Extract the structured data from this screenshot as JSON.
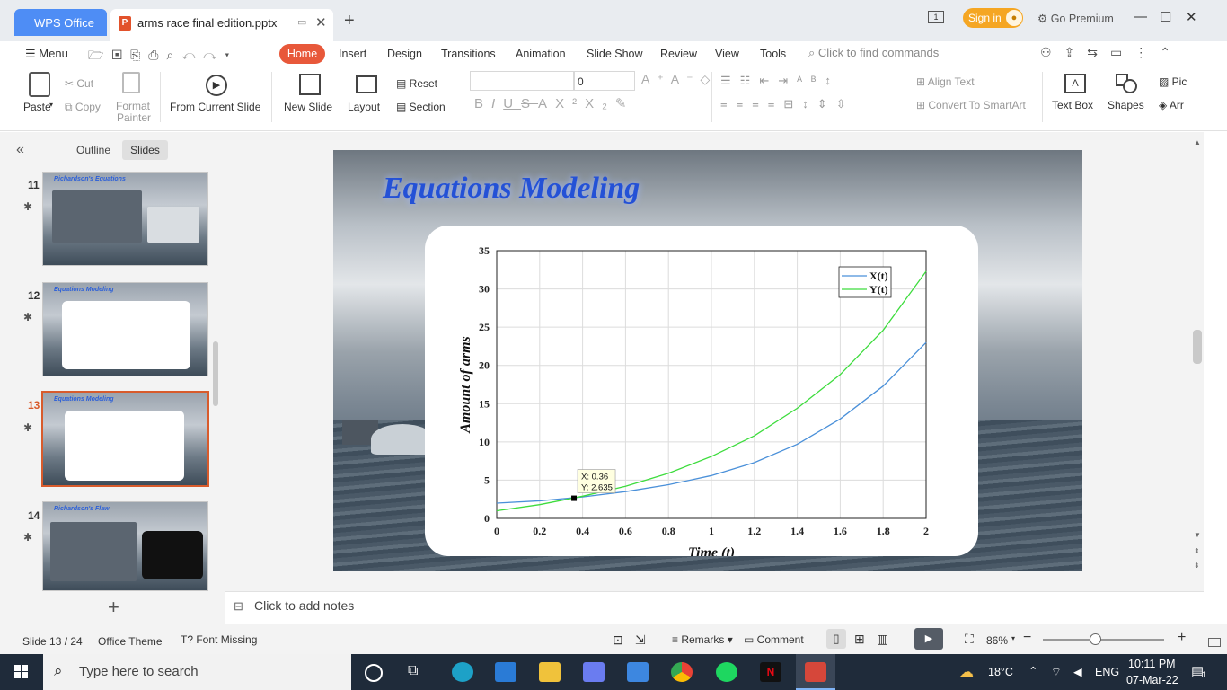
{
  "titlebar": {
    "app_tab": "WPS Office",
    "doc_tab": "arms race final edition.pptx",
    "doc_icon_letter": "P",
    "new_tab_icon": "plus-icon",
    "pages_badge": "1",
    "signin": "Sign in",
    "go_premium": "Go Premium"
  },
  "menu": {
    "menu_label": "Menu",
    "tabs": [
      "Home",
      "Insert",
      "Design",
      "Transitions",
      "Animation",
      "Slide Show",
      "Review",
      "View",
      "Tools"
    ],
    "search_placeholder": "Click to find commands"
  },
  "ribbon": {
    "paste": "Paste",
    "cut": "Cut",
    "copy": "Copy",
    "format_painter_1": "Format",
    "format_painter_2": "Painter",
    "from_current_slide": "From Current Slide",
    "new_slide": "New Slide",
    "layout": "Layout",
    "reset": "Reset",
    "section": "Section",
    "font_size": "0",
    "align_text": "Align Text",
    "convert_smartart": "Convert To SmartArt",
    "text_box": "Text Box",
    "shapes": "Shapes",
    "pic": "Pic",
    "arr": "Arr"
  },
  "left_panel": {
    "outline": "Outline",
    "slides": "Slides",
    "thumbnails": [
      {
        "num": "11",
        "title": "Richardson's Equations"
      },
      {
        "num": "12",
        "title": "Equations Modeling"
      },
      {
        "num": "13",
        "title": "Equations Modeling"
      },
      {
        "num": "14",
        "title": "Richardson's Flaw"
      }
    ]
  },
  "slide": {
    "title": "Equations Modeling"
  },
  "chart_data": {
    "type": "line",
    "title": "",
    "xlabel": "Time (t)",
    "ylabel": "Amount of arms",
    "xlim": [
      0,
      2
    ],
    "ylim": [
      0,
      35
    ],
    "xticks": [
      "0",
      "0.2",
      "0.4",
      "0.6",
      "0.8",
      "1",
      "1.2",
      "1.4",
      "1.6",
      "1.8",
      "2"
    ],
    "yticks": [
      "0",
      "5",
      "10",
      "15",
      "20",
      "25",
      "30",
      "35"
    ],
    "grid": true,
    "legend_position": "top-right",
    "series": [
      {
        "name": "X(t)",
        "color": "#4a90d9",
        "x": [
          0,
          0.2,
          0.4,
          0.6,
          0.8,
          1.0,
          1.2,
          1.4,
          1.6,
          1.8,
          2.0
        ],
        "y": [
          2.0,
          2.3,
          2.8,
          3.5,
          4.4,
          5.6,
          7.3,
          9.7,
          13.0,
          17.3,
          23.0
        ]
      },
      {
        "name": "Y(t)",
        "color": "#3ddc3d",
        "x": [
          0,
          0.2,
          0.4,
          0.6,
          0.8,
          1.0,
          1.2,
          1.4,
          1.6,
          1.8,
          2.0
        ],
        "y": [
          1.0,
          1.8,
          2.9,
          4.2,
          5.9,
          8.1,
          10.8,
          14.4,
          18.8,
          24.6,
          32.3
        ]
      }
    ],
    "datatip": {
      "x": 0.36,
      "y": 2.635,
      "label_x": "X: 0.36",
      "label_y": "Y: 2.635"
    }
  },
  "notes": {
    "placeholder": "Click to add notes"
  },
  "status": {
    "slide_counter": "Slide 13 / 24",
    "theme": "Office Theme",
    "font_missing": "Font Missing",
    "remarks": "Remarks",
    "comment": "Comment",
    "zoom": "86%"
  },
  "taskbar": {
    "search": "Type here to search",
    "weather": "18°C",
    "lang": "ENG",
    "time": "10:11 PM",
    "date": "07-Mar-22",
    "notif_count": "1"
  }
}
